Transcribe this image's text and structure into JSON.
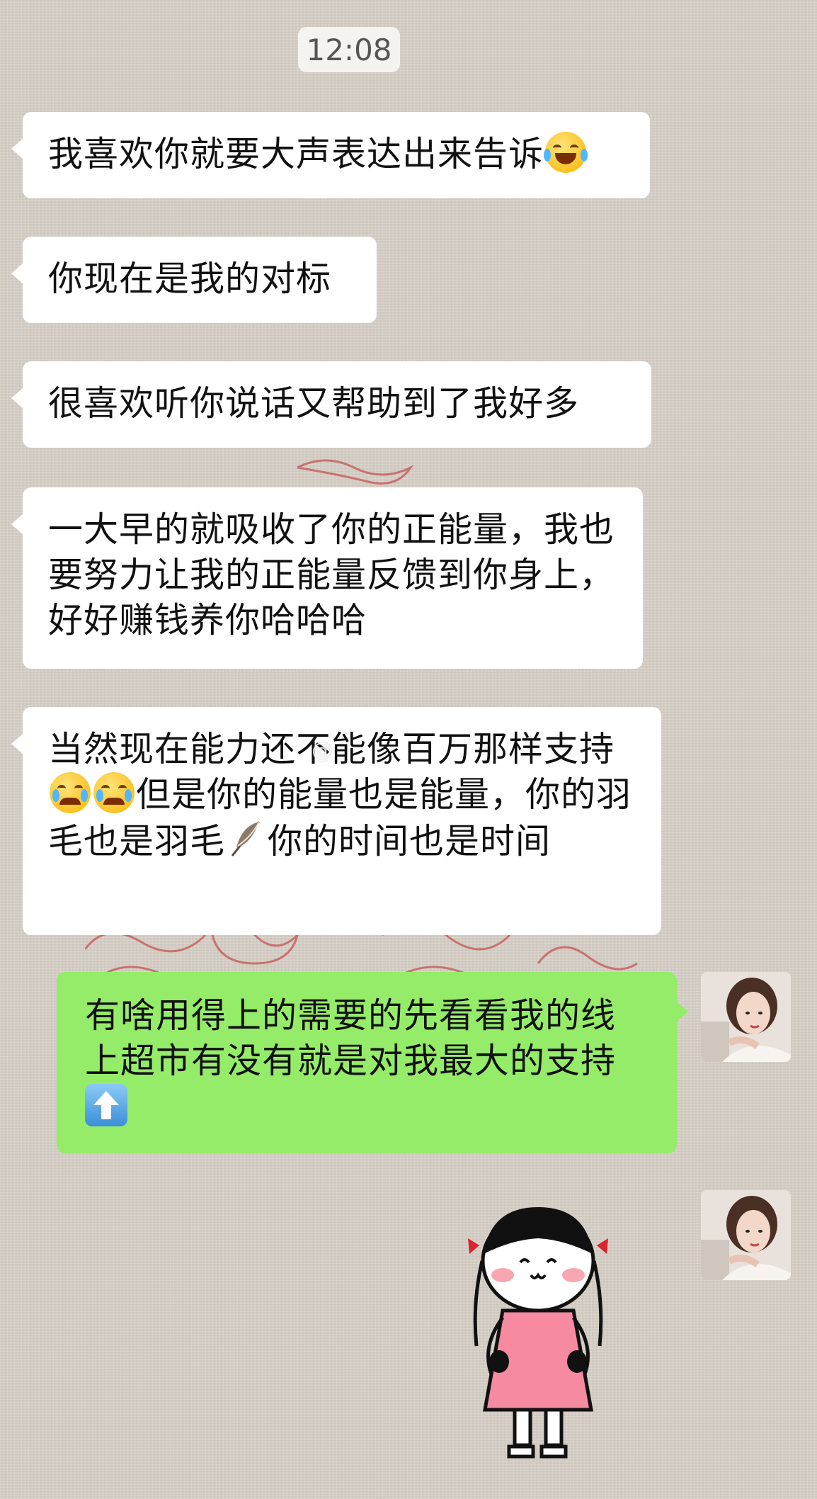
{
  "chat": {
    "timestamp": "12:08",
    "messages": [
      {
        "side": "in",
        "parts": [
          "我喜欢你就要大声表达出来告诉"
        ],
        "emoji_end": "laughing-tears-emoji"
      },
      {
        "side": "in",
        "parts": [
          "你现在是我的对标"
        ]
      },
      {
        "side": "in",
        "parts": [
          "很喜欢听你说话又帮助到了我好多"
        ]
      },
      {
        "side": "in",
        "parts": [
          "一大早的就吸收了你的正能量，我也要努力让我的正能量反馈到你身上，好好赚钱养你哈哈哈"
        ]
      },
      {
        "side": "in",
        "parts": [
          "当然现在能力还不能像百万那样支持",
          "但是你的能量也是能量，你的羽毛也是羽毛",
          "你的时间也是时间"
        ],
        "emojis": [
          "crying-emoji",
          "crying-emoji",
          "feather-emoji"
        ]
      },
      {
        "side": "out",
        "parts": [
          "有啥用得上的需要的先看看我的线上超市有没有就是对我最大的支持"
        ],
        "emoji_end": "up-arrow-emoji"
      }
    ],
    "sticker": "girl-pink-dress-sticker",
    "watermark": "@"
  },
  "colors": {
    "incoming_bubble": "#ffffff",
    "outgoing_bubble": "#95ec69",
    "background": "#d6cfc6",
    "seal_red": "#c0292b"
  }
}
